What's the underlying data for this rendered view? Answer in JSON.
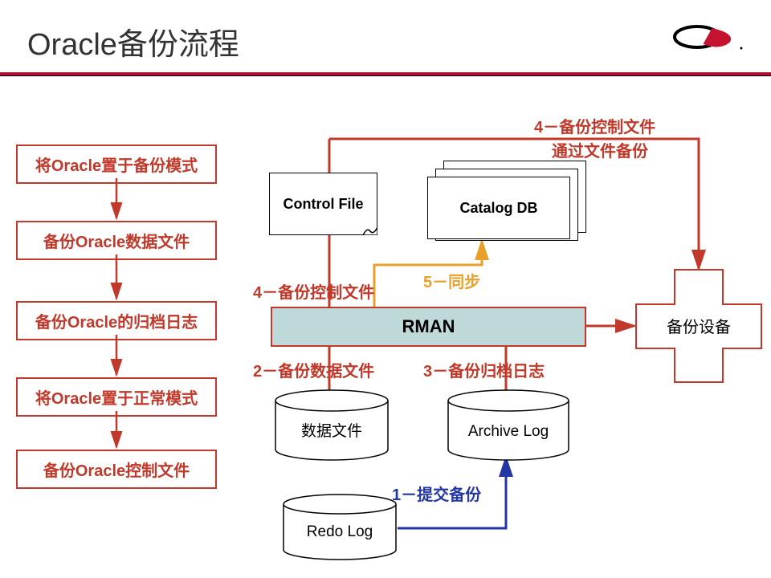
{
  "title": "Oracle备份流程",
  "flow": {
    "s1": "将Oracle置于备份模式",
    "s2": "备份Oracle数据文件",
    "s3": "备份Oracle的归档日志",
    "s4": "将Oracle置于正常模式",
    "s5": "备份Oracle控制文件"
  },
  "nodes": {
    "control_file": "Control File",
    "catalog_db": "Catalog DB",
    "rman": "RMAN",
    "backup_device": "备份设备",
    "data_file": "数据文件",
    "archive_log": "Archive Log",
    "redo_log": "Redo Log"
  },
  "labels": {
    "l1": "1－提交备份",
    "l2": "2－备份数据文件",
    "l3": "3－备份归档日志",
    "l4a": "4－备份控制文件",
    "l4b_line1": "4－备份控制文件",
    "l4b_line2": "通过文件备份",
    "l5": "5－同步"
  }
}
